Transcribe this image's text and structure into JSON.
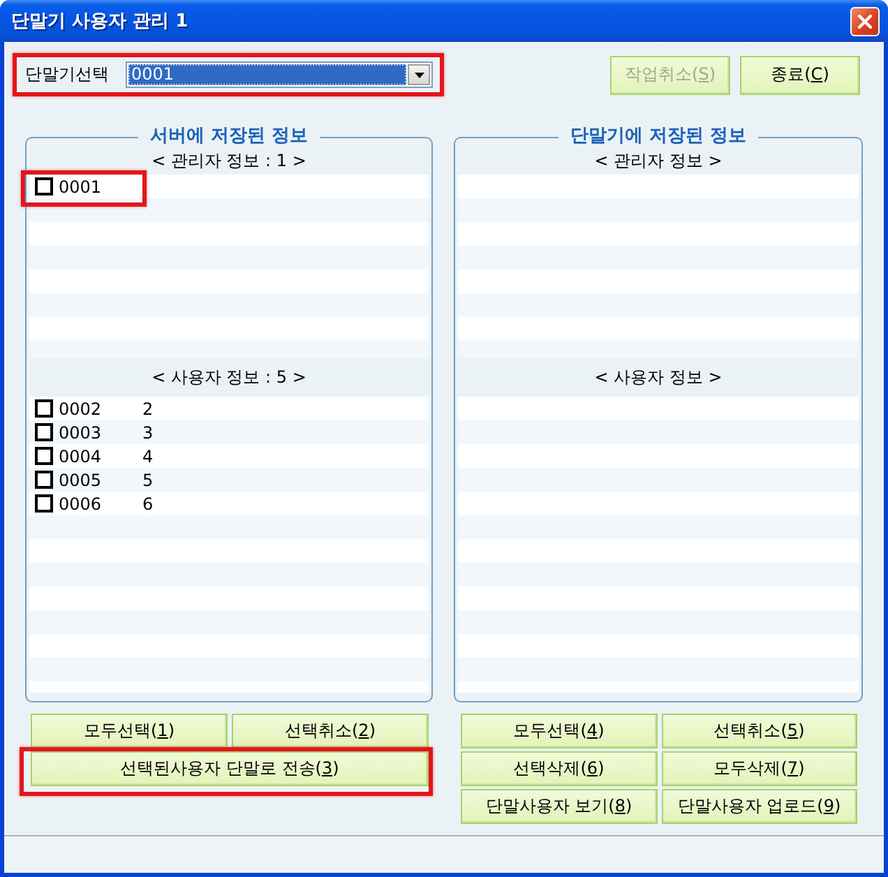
{
  "window": {
    "title": "단말기 사용자 관리 1"
  },
  "terminal_select": {
    "label": "단말기선택",
    "value": "0001",
    "highlighted": true
  },
  "top_buttons": [
    {
      "label_start": "작업취소(",
      "access_key": "S",
      "label_end": ")",
      "disabled": true
    },
    {
      "label_start": "종료(",
      "access_key": "C",
      "label_end": ")",
      "disabled": false
    }
  ],
  "groups": [
    {
      "title": "서버에 저장된 정보",
      "admin": {
        "header": "< 관리자 정보 : 1 >",
        "items": [
          {
            "checked": false,
            "column_1": "0001",
            "highlighted": true
          }
        ]
      },
      "users": {
        "header": "< 사용자 정보 : 5 >",
        "items": [
          {
            "checked": false,
            "column_1": "0002",
            "column_2": "2"
          },
          {
            "checked": false,
            "column_1": "0003",
            "column_2": "3"
          },
          {
            "checked": false,
            "column_1": "0004",
            "column_2": "4"
          },
          {
            "checked": false,
            "column_1": "0005",
            "column_2": "5"
          },
          {
            "checked": false,
            "column_1": "0006",
            "column_2": "6"
          }
        ]
      },
      "buttons": [
        {
          "label_start": "모두선택(",
          "access_key": "1",
          "label_end": ")",
          "wide": false,
          "highlighted": false
        },
        {
          "label_start": "선택취소(",
          "access_key": "2",
          "label_end": ")",
          "wide": false,
          "highlighted": false
        },
        {
          "label_start": "선택된사용자 단말로 전송(",
          "access_key": "3",
          "label_end": ")",
          "wide": true,
          "highlighted": true
        }
      ]
    },
    {
      "title": "단말기에 저장된 정보",
      "admin": {
        "header": "< 관리자 정보 >"
      },
      "users": {
        "header": "< 사용자 정보 >"
      },
      "buttons": [
        {
          "label_start": "모두선택(",
          "access_key": "4",
          "label_end": ")",
          "wide": false,
          "highlighted": false
        },
        {
          "label_start": "선택취소(",
          "access_key": "5",
          "label_end": ")",
          "wide": false,
          "highlighted": false
        },
        {
          "label_start": "선택삭제(",
          "access_key": "6",
          "label_end": ")",
          "wide": false,
          "highlighted": false
        },
        {
          "label_start": "모두삭제(",
          "access_key": "7",
          "label_end": ")",
          "wide": false,
          "highlighted": false
        },
        {
          "label_start": "단말사용자 보기(",
          "access_key": "8",
          "label_end": ")",
          "wide": false,
          "highlighted": false
        },
        {
          "label_start": "단말사용자 업로드(",
          "access_key": "9",
          "label_end": ")",
          "wide": false,
          "highlighted": false
        }
      ]
    }
  ]
}
